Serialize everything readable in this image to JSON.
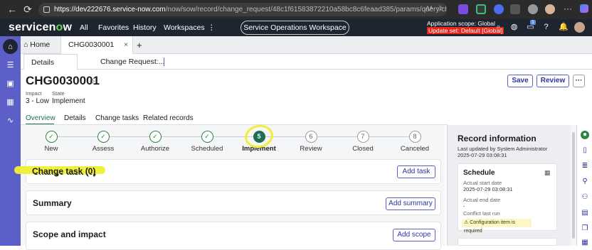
{
  "browser": {
    "url_host": "https://dev222676.service-now.com",
    "url_path": "/now/sow/record/change_request/48c1f61583872210a58bc8c6feaad385/params/query/chg_model%3D007c4001...",
    "read_aloud": "Aᴬ"
  },
  "header": {
    "logo_a": "servicen",
    "logo_o": "o",
    "logo_b": "w",
    "nav": [
      "All",
      "Favorites",
      "History",
      "Workspaces"
    ],
    "workspace_pill": "Service Operations Workspace ☆",
    "scope_line1": "Application scope: Global",
    "scope_line2": "Update set: Default [Global]",
    "notif_count": "1"
  },
  "tabs": {
    "home": "Home",
    "record_tab": "CHG0030001",
    "close": "×",
    "add": "+",
    "subtab_details": "Details",
    "subtab_change_request": "Change Request:..."
  },
  "record": {
    "number": "CHG0030001",
    "impact_label": "Impact",
    "impact_value": "3 - Low",
    "state_label": "State",
    "state_value": "Implement",
    "save": "Save",
    "review": "Review",
    "more": "···"
  },
  "record_tabs": [
    "Overview",
    "Details",
    "Change tasks",
    "Related records"
  ],
  "stepper": [
    {
      "label": "New",
      "status": "done",
      "num": "✓"
    },
    {
      "label": "Assess",
      "status": "done",
      "num": "✓"
    },
    {
      "label": "Authorize",
      "status": "done",
      "num": "✓"
    },
    {
      "label": "Scheduled",
      "status": "done",
      "num": "✓"
    },
    {
      "label": "Implement",
      "status": "current",
      "num": "5"
    },
    {
      "label": "Review",
      "status": "future",
      "num": "6"
    },
    {
      "label": "Closed",
      "status": "future",
      "num": "7"
    },
    {
      "label": "Canceled",
      "status": "future",
      "num": "8"
    }
  ],
  "cards": {
    "change_task_title": "Change task (0)",
    "change_task_button": "Add task",
    "summary_title": "Summary",
    "summary_button": "Add summary",
    "scope_title": "Scope and impact",
    "scope_button": "Add scope"
  },
  "record_info": {
    "title": "Record information",
    "last_updated": "Last updated by System Administrator",
    "last_updated_time": "2025-07-29 03:08:31",
    "schedule_title": "Schedule",
    "actual_start_label": "Actual start date",
    "actual_start_value": "2025-07-29 03:08:31",
    "actual_end_label": "Actual end date",
    "actual_end_value": "-",
    "conflict_label": "Conflict last run",
    "warning": "⚠ Configuration item is required"
  }
}
